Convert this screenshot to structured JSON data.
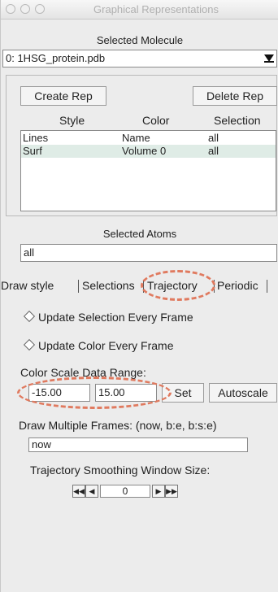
{
  "window": {
    "title": "Graphical Representations"
  },
  "molecule": {
    "heading": "Selected Molecule",
    "selected": "0: 1HSG_protein.pdb"
  },
  "reps": {
    "create_label": "Create Rep",
    "delete_label": "Delete Rep",
    "columns": [
      "Style",
      "Color",
      "Selection"
    ],
    "rows": [
      {
        "style": "Lines",
        "color": "Name",
        "selection": "all",
        "selected": false
      },
      {
        "style": "Surf",
        "color": "Volume 0",
        "selection": "all",
        "selected": true
      }
    ]
  },
  "atoms": {
    "heading": "Selected Atoms",
    "value": "all"
  },
  "tabs": [
    "Draw style",
    "Selections",
    "Trajectory",
    "Periodic"
  ],
  "active_tab": "Trajectory",
  "trajectory": {
    "update_selection_label": "Update Selection Every Frame",
    "update_color_label": "Update Color Every Frame",
    "color_scale_label": "Color Scale Data Range:",
    "range_min": "-15.00",
    "range_max": "15.00",
    "set_label": "Set",
    "autoscale_label": "Autoscale",
    "multiframe_label": "Draw Multiple Frames: (now, b:e, b:s:e)",
    "multiframe_value": "now",
    "smoothing_label": "Trajectory Smoothing Window Size:",
    "smoothing_value": "0"
  },
  "annotation": {
    "color": "#e07a5f"
  }
}
